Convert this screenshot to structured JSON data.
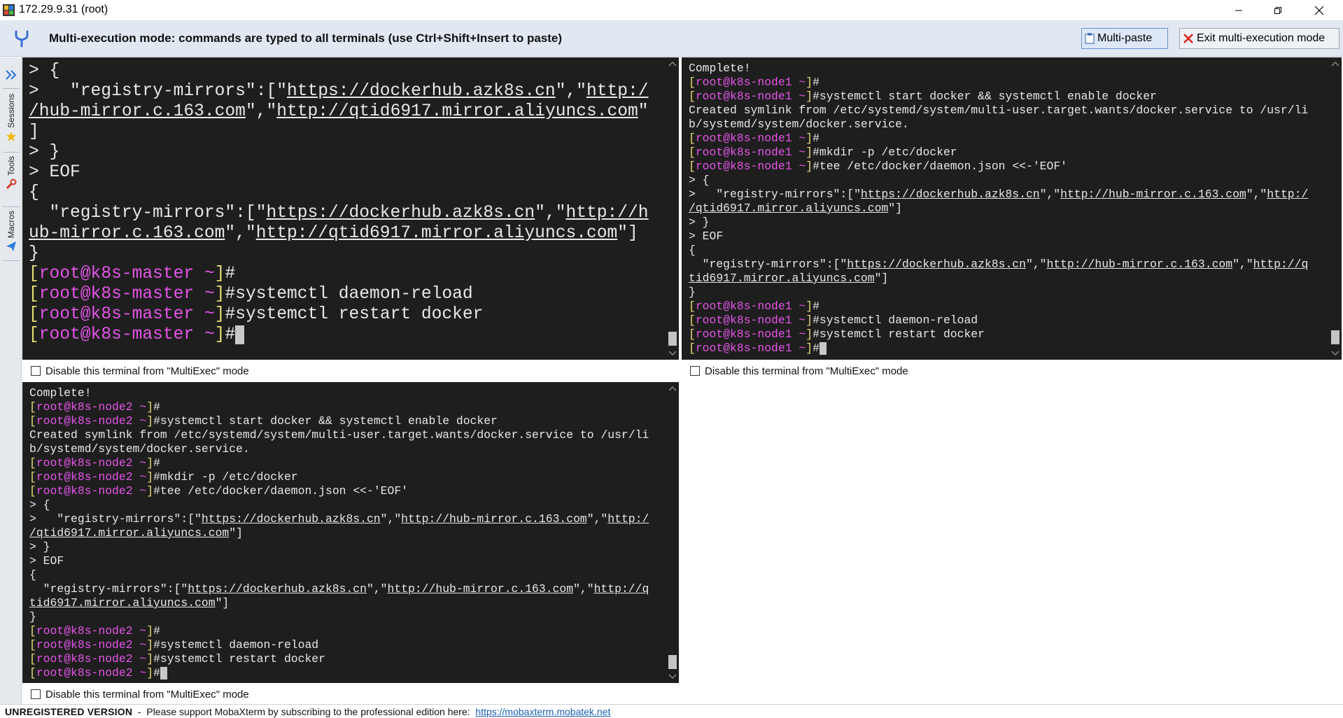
{
  "window": {
    "title": "172.29.9.31 (root)"
  },
  "banner": {
    "message": "Multi-execution mode: commands are typed to all terminals (use Ctrl+Shift+Insert to paste)",
    "multi_paste_label": "Multi-paste",
    "exit_label": "Exit multi-execution mode"
  },
  "sidebar": {
    "tabs": [
      {
        "label": "Sessions"
      },
      {
        "label": "Tools"
      },
      {
        "label": "Macros"
      }
    ]
  },
  "checkbox_label": "Disable this terminal from \"MultiExec\" mode",
  "colors": {
    "terminal_bg": "#1e1e1e",
    "bracket": "#e6db74",
    "user_host": "#e454e8",
    "banner_bg": "#e1e8f2"
  },
  "terminals": {
    "master": {
      "lines": [
        [
          {
            "t": "> {"
          }
        ],
        [
          {
            "t": ">   \"registry-mirrors\":[\""
          },
          {
            "t": "https://dockerhub.azk8s.cn",
            "c": "url"
          },
          {
            "t": "\",\""
          },
          {
            "t": "http:/",
            "c": "url"
          }
        ],
        [
          {
            "t": "/hub-mirror.c.163.com",
            "c": "url"
          },
          {
            "t": "\",\""
          },
          {
            "t": "http://qtid6917.mirror.aliyuncs.com",
            "c": "url"
          },
          {
            "t": "\""
          }
        ],
        [
          {
            "t": "]"
          }
        ],
        [
          {
            "t": "> }"
          }
        ],
        [
          {
            "t": "> EOF"
          }
        ],
        [
          {
            "t": "{"
          }
        ],
        [
          {
            "t": "  \"registry-mirrors\":[\""
          },
          {
            "t": "https://dockerhub.azk8s.cn",
            "c": "url"
          },
          {
            "t": "\",\""
          },
          {
            "t": "http://h",
            "c": "url"
          }
        ],
        [
          {
            "t": "ub-mirror.c.163.com",
            "c": "url"
          },
          {
            "t": "\",\""
          },
          {
            "t": "http://qtid6917.mirror.aliyuncs.com",
            "c": "url"
          },
          {
            "t": "\"]"
          }
        ],
        [
          {
            "t": "}"
          }
        ],
        [
          {
            "t": "[",
            "c": "pr-b"
          },
          {
            "t": "root@k8s-master ~",
            "c": "pr-u"
          },
          {
            "t": "]",
            "c": "pr-b"
          },
          {
            "t": "#"
          }
        ],
        [
          {
            "t": "[",
            "c": "pr-b"
          },
          {
            "t": "root@k8s-master ~",
            "c": "pr-u"
          },
          {
            "t": "]",
            "c": "pr-b"
          },
          {
            "t": "#systemctl daemon-reload"
          }
        ],
        [
          {
            "t": "[",
            "c": "pr-b"
          },
          {
            "t": "root@k8s-master ~",
            "c": "pr-u"
          },
          {
            "t": "]",
            "c": "pr-b"
          },
          {
            "t": "#systemctl restart docker"
          }
        ],
        [
          {
            "t": "[",
            "c": "pr-b"
          },
          {
            "t": "root@k8s-master ~",
            "c": "pr-u"
          },
          {
            "t": "]",
            "c": "pr-b"
          },
          {
            "t": "#"
          },
          {
            "c": "cursor"
          }
        ]
      ]
    },
    "node1": {
      "lines": [
        [
          {
            "t": "Complete!"
          }
        ],
        [
          {
            "t": "[",
            "c": "pr-b"
          },
          {
            "t": "root@k8s-node1 ~",
            "c": "pr-u"
          },
          {
            "t": "]",
            "c": "pr-b"
          },
          {
            "t": "#"
          }
        ],
        [
          {
            "t": "[",
            "c": "pr-b"
          },
          {
            "t": "root@k8s-node1 ~",
            "c": "pr-u"
          },
          {
            "t": "]",
            "c": "pr-b"
          },
          {
            "t": "#systemctl start docker && systemctl enable docker"
          }
        ],
        [
          {
            "t": "Created symlink from /etc/systemd/system/multi-user.target.wants/docker.service to /usr/li"
          }
        ],
        [
          {
            "t": "b/systemd/system/docker.service."
          }
        ],
        [
          {
            "t": "[",
            "c": "pr-b"
          },
          {
            "t": "root@k8s-node1 ~",
            "c": "pr-u"
          },
          {
            "t": "]",
            "c": "pr-b"
          },
          {
            "t": "#"
          }
        ],
        [
          {
            "t": "[",
            "c": "pr-b"
          },
          {
            "t": "root@k8s-node1 ~",
            "c": "pr-u"
          },
          {
            "t": "]",
            "c": "pr-b"
          },
          {
            "t": "#mkdir -p /etc/docker"
          }
        ],
        [
          {
            "t": "[",
            "c": "pr-b"
          },
          {
            "t": "root@k8s-node1 ~",
            "c": "pr-u"
          },
          {
            "t": "]",
            "c": "pr-b"
          },
          {
            "t": "#tee /etc/docker/daemon.json <<-'EOF'"
          }
        ],
        [
          {
            "t": "> {"
          }
        ],
        [
          {
            "t": ">   \"registry-mirrors\":[\""
          },
          {
            "t": "https://dockerhub.azk8s.cn",
            "c": "url"
          },
          {
            "t": "\",\""
          },
          {
            "t": "http://hub-mirror.c.163.com",
            "c": "url"
          },
          {
            "t": "\",\""
          },
          {
            "t": "http:/",
            "c": "url"
          }
        ],
        [
          {
            "t": "/qtid6917.mirror.aliyuncs.com",
            "c": "url"
          },
          {
            "t": "\"]"
          }
        ],
        [
          {
            "t": "> }"
          }
        ],
        [
          {
            "t": "> EOF"
          }
        ],
        [
          {
            "t": "{"
          }
        ],
        [
          {
            "t": "  \"registry-mirrors\":[\""
          },
          {
            "t": "https://dockerhub.azk8s.cn",
            "c": "url"
          },
          {
            "t": "\",\""
          },
          {
            "t": "http://hub-mirror.c.163.com",
            "c": "url"
          },
          {
            "t": "\",\""
          },
          {
            "t": "http://q",
            "c": "url"
          }
        ],
        [
          {
            "t": "tid6917.mirror.aliyuncs.com",
            "c": "url"
          },
          {
            "t": "\"]"
          }
        ],
        [
          {
            "t": "}"
          }
        ],
        [
          {
            "t": "[",
            "c": "pr-b"
          },
          {
            "t": "root@k8s-node1 ~",
            "c": "pr-u"
          },
          {
            "t": "]",
            "c": "pr-b"
          },
          {
            "t": "#"
          }
        ],
        [
          {
            "t": "[",
            "c": "pr-b"
          },
          {
            "t": "root@k8s-node1 ~",
            "c": "pr-u"
          },
          {
            "t": "]",
            "c": "pr-b"
          },
          {
            "t": "#systemctl daemon-reload"
          }
        ],
        [
          {
            "t": "[",
            "c": "pr-b"
          },
          {
            "t": "root@k8s-node1 ~",
            "c": "pr-u"
          },
          {
            "t": "]",
            "c": "pr-b"
          },
          {
            "t": "#systemctl restart docker"
          }
        ],
        [
          {
            "t": "[",
            "c": "pr-b"
          },
          {
            "t": "root@k8s-node1 ~",
            "c": "pr-u"
          },
          {
            "t": "]",
            "c": "pr-b"
          },
          {
            "t": "#"
          },
          {
            "c": "cursor"
          }
        ]
      ]
    },
    "node2": {
      "lines": [
        [
          {
            "t": "Complete!"
          }
        ],
        [
          {
            "t": "[",
            "c": "pr-b"
          },
          {
            "t": "root@k8s-node2 ~",
            "c": "pr-u"
          },
          {
            "t": "]",
            "c": "pr-b"
          },
          {
            "t": "#"
          }
        ],
        [
          {
            "t": "[",
            "c": "pr-b"
          },
          {
            "t": "root@k8s-node2 ~",
            "c": "pr-u"
          },
          {
            "t": "]",
            "c": "pr-b"
          },
          {
            "t": "#systemctl start docker && systemctl enable docker"
          }
        ],
        [
          {
            "t": "Created symlink from /etc/systemd/system/multi-user.target.wants/docker.service to /usr/li"
          }
        ],
        [
          {
            "t": "b/systemd/system/docker.service."
          }
        ],
        [
          {
            "t": "[",
            "c": "pr-b"
          },
          {
            "t": "root@k8s-node2 ~",
            "c": "pr-u"
          },
          {
            "t": "]",
            "c": "pr-b"
          },
          {
            "t": "#"
          }
        ],
        [
          {
            "t": "[",
            "c": "pr-b"
          },
          {
            "t": "root@k8s-node2 ~",
            "c": "pr-u"
          },
          {
            "t": "]",
            "c": "pr-b"
          },
          {
            "t": "#mkdir -p /etc/docker"
          }
        ],
        [
          {
            "t": "[",
            "c": "pr-b"
          },
          {
            "t": "root@k8s-node2 ~",
            "c": "pr-u"
          },
          {
            "t": "]",
            "c": "pr-b"
          },
          {
            "t": "#tee /etc/docker/daemon.json <<-'EOF'"
          }
        ],
        [
          {
            "t": "> {"
          }
        ],
        [
          {
            "t": ">   \"registry-mirrors\":[\""
          },
          {
            "t": "https://dockerhub.azk8s.cn",
            "c": "url"
          },
          {
            "t": "\",\""
          },
          {
            "t": "http://hub-mirror.c.163.com",
            "c": "url"
          },
          {
            "t": "\",\""
          },
          {
            "t": "http:/",
            "c": "url"
          }
        ],
        [
          {
            "t": "/qtid6917.mirror.aliyuncs.com",
            "c": "url"
          },
          {
            "t": "\"]"
          }
        ],
        [
          {
            "t": "> }"
          }
        ],
        [
          {
            "t": "> EOF"
          }
        ],
        [
          {
            "t": "{"
          }
        ],
        [
          {
            "t": "  \"registry-mirrors\":[\""
          },
          {
            "t": "https://dockerhub.azk8s.cn",
            "c": "url"
          },
          {
            "t": "\",\""
          },
          {
            "t": "http://hub-mirror.c.163.com",
            "c": "url"
          },
          {
            "t": "\",\""
          },
          {
            "t": "http://q",
            "c": "url"
          }
        ],
        [
          {
            "t": "tid6917.mirror.aliyuncs.com",
            "c": "url"
          },
          {
            "t": "\"]"
          }
        ],
        [
          {
            "t": "}"
          }
        ],
        [
          {
            "t": "[",
            "c": "pr-b"
          },
          {
            "t": "root@k8s-node2 ~",
            "c": "pr-u"
          },
          {
            "t": "]",
            "c": "pr-b"
          },
          {
            "t": "#"
          }
        ],
        [
          {
            "t": "[",
            "c": "pr-b"
          },
          {
            "t": "root@k8s-node2 ~",
            "c": "pr-u"
          },
          {
            "t": "]",
            "c": "pr-b"
          },
          {
            "t": "#systemctl daemon-reload"
          }
        ],
        [
          {
            "t": "[",
            "c": "pr-b"
          },
          {
            "t": "root@k8s-node2 ~",
            "c": "pr-u"
          },
          {
            "t": "]",
            "c": "pr-b"
          },
          {
            "t": "#systemctl restart docker"
          }
        ],
        [
          {
            "t": "[",
            "c": "pr-b"
          },
          {
            "t": "root@k8s-node2 ~",
            "c": "pr-u"
          },
          {
            "t": "]",
            "c": "pr-b"
          },
          {
            "t": "#"
          },
          {
            "c": "cursor"
          }
        ]
      ]
    }
  },
  "status_bar": {
    "unregistered": "UNREGISTERED VERSION",
    "message": "  -  Please support MobaXterm by subscribing to the professional edition here:  ",
    "link": "https://mobaxterm.mobatek.net"
  }
}
